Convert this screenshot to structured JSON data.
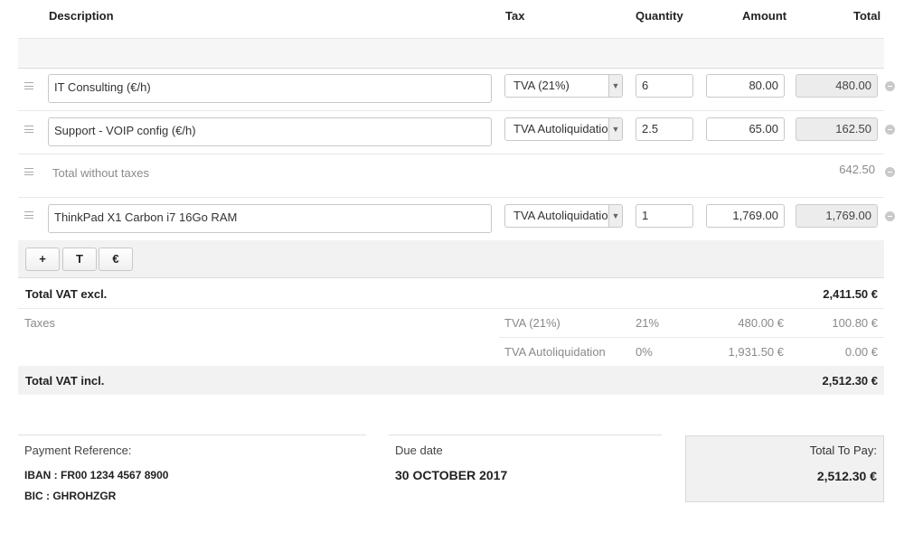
{
  "table": {
    "headers": {
      "description": "Description",
      "tax": "Tax",
      "quantity": "Quantity",
      "amount": "Amount",
      "total": "Total"
    },
    "lines": [
      {
        "description": "IT Consulting (€/h)",
        "tax": "TVA (21%)",
        "quantity": "6",
        "amount": "80.00",
        "total": "480.00"
      },
      {
        "description": "Support - VOIP config (€/h)",
        "tax": "TVA Autoliquidation",
        "quantity": "2.5",
        "amount": "65.00",
        "total": "162.50"
      },
      {
        "description": "ThinkPad X1 Carbon i7 16Go RAM",
        "tax": "TVA Autoliquidation",
        "quantity": "1",
        "amount": "1,769.00",
        "total": "1,769.00"
      }
    ],
    "subtotal": {
      "label": "Total without taxes",
      "value": "642.50"
    }
  },
  "toolbar": {
    "add_line": "+",
    "add_text": "T",
    "add_subtotal": "€"
  },
  "summary": {
    "vat_excl": {
      "label": "Total VAT excl.",
      "value": "2,411.50 €"
    },
    "taxes_label": "Taxes",
    "taxes": [
      {
        "name": "TVA (21%)",
        "rate": "21%",
        "base": "480.00 €",
        "amount": "100.80 €"
      },
      {
        "name": "TVA Autoliquidation",
        "rate": "0%",
        "base": "1,931.50 €",
        "amount": "0.00 €"
      }
    ],
    "vat_incl": {
      "label": "Total VAT incl.",
      "value": "2,512.30 €"
    }
  },
  "footer": {
    "payment": {
      "label": "Payment Reference:",
      "iban": "IBAN : FR00 1234 4567 8900",
      "bic": "BIC : GHROHZGR"
    },
    "due": {
      "label": "Due date",
      "value": "30 OCTOBER 2017"
    },
    "to_pay": {
      "label": "Total To Pay:",
      "value": "2,512.30 €"
    }
  }
}
